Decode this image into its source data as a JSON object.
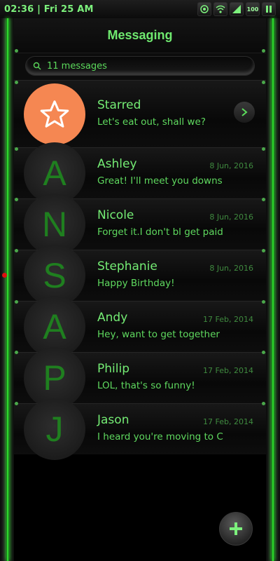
{
  "status": {
    "time": "02:36 | Fri 25 AM",
    "battery": "100",
    "icons": [
      "target-icon",
      "wifi-icon",
      "signal-icon",
      "battery-icon",
      "pause-icon"
    ]
  },
  "header": {
    "title": "Messaging"
  },
  "search": {
    "text": "11 messages",
    "icon": "search-icon"
  },
  "starred": {
    "name": "Starred",
    "preview": "Let's eat out, shall we?",
    "icon": "star-icon"
  },
  "conversations": [
    {
      "initial": "A",
      "name": "Ashley",
      "date": "8 Jun, 2016",
      "preview": "Great! I'll meet you downs…"
    },
    {
      "initial": "N",
      "name": "Nicole",
      "date": "8 Jun, 2016",
      "preview": "Forget it.I don't bl get paid…"
    },
    {
      "initial": "S",
      "name": "Stephanie",
      "date": "8 Jun, 2016",
      "preview": "Happy Birthday!",
      "unread": true
    },
    {
      "initial": "A",
      "name": "Andy",
      "date": "17 Feb, 2014",
      "preview": "Hey, want to get together …"
    },
    {
      "initial": "P",
      "name": "Philip",
      "date": "17 Feb, 2014",
      "preview": "LOL, that's so funny!"
    },
    {
      "initial": "J",
      "name": "Jason",
      "date": "17 Feb, 2014",
      "preview": "I heard you're moving to C…"
    }
  ],
  "colors": {
    "accent": "#5bdc5b",
    "star": "#f58752",
    "unread": "#e01010"
  }
}
